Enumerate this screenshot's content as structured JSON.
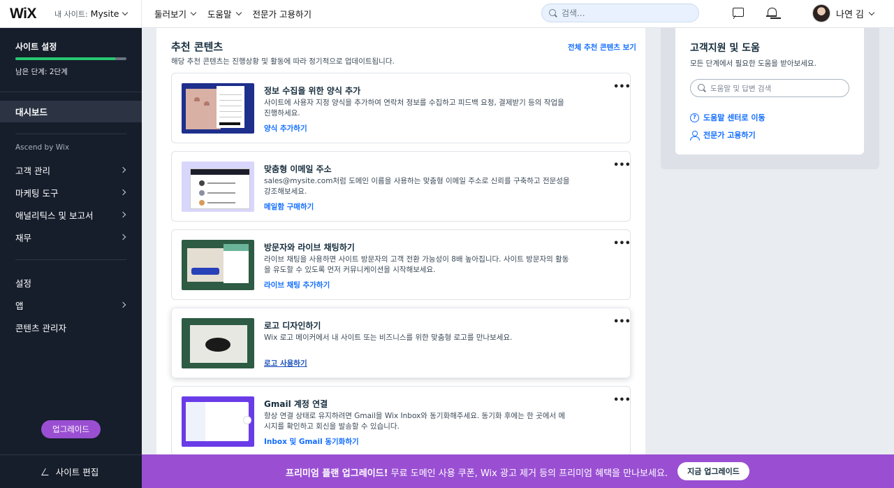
{
  "topbar": {
    "logo": "WiX",
    "site_label": "내 사이트:",
    "site_name": "Mysite",
    "nav": [
      "둘러보기",
      "도움말",
      "전문가 고용하기"
    ],
    "search_placeholder": "검색...",
    "user_name": "나연 김"
  },
  "sidebar": {
    "setup_title": "사이트 설정",
    "setup_steps": "남은 단계: 2단계",
    "setup_progress": 0.9,
    "dashboard": "대시보드",
    "group_label": "Ascend by Wix",
    "group_items": [
      "고객 관리",
      "마케팅 도구",
      "애널리틱스 및 보고서",
      "재무"
    ],
    "settings": "설정",
    "apps": "앱",
    "content_manager": "콘텐츠 관리자",
    "upgrade": "업그레이드",
    "edit_site": "사이트 편집"
  },
  "main": {
    "title": "추천 콘텐츠",
    "subtitle": "해당 추천 콘텐츠는 진행상황 및 활동에 따라 정기적으로 업데이트됩니다.",
    "see_all": "전체 추천 콘텐츠 보기",
    "more_label": "•••",
    "cards": [
      {
        "title": "정보 수집을 위한 양식 추가",
        "desc": "사이트에 사용자 지정 양식을 추가하여 연락처 정보를 수집하고 피드백 요청, 결제받기 등의 작업을 진행하세요.",
        "link": "양식 추가하기"
      },
      {
        "title": "맞춤형 이메일 주소",
        "desc": "sales@mysite.com처럼 도메인 이름을 사용하는 맞춤형 이메일 주소로 신뢰를 구축하고 전문성을 강조해보세요.",
        "link": "메일함 구매하기"
      },
      {
        "title": "방문자와 라이브 채팅하기",
        "desc": "라이브 채팅을 사용하면 사이트 방문자의 고객 전환 가능성이 8배 높아집니다. 사이트 방문자의 활동을 유도할 수 있도록 먼저 커뮤니케이션을 시작해보세요.",
        "link": "라이브 채팅 추가하기"
      },
      {
        "title": "로고 디자인하기",
        "desc": "Wix 로고 메이커에서 내 사이트 또는 비즈니스를 위한 맞춤형 로고를 만나보세요.",
        "link": "로고 사용하기"
      },
      {
        "title": "Gmail 계정 연결",
        "desc": "항상 연결 상태로 유지하려면 Gmail을 Wix Inbox와 동기화해주세요. 동기화 후에는 한 곳에서 메시지를 확인하고 회신을 발송할 수 있습니다.",
        "link": "Inbox 및 Gmail 동기화하기"
      }
    ]
  },
  "help": {
    "title": "고객지원 및 도움",
    "subtitle": "모든 단계에서 필요한 도움을 받아보세요.",
    "search_placeholder": "도움말 및 답변 검색",
    "links": [
      "도움말 센터로 이동",
      "전문가 고용하기"
    ]
  },
  "banner": {
    "bold": "프리미엄 플랜 업그레이드!",
    "text": " 무료 도메인 사용 쿠폰, Wix 광고 제거 등의 프리미엄 혜택을 만나보세요.",
    "cta": "지금 업그레이드"
  },
  "colors": {
    "accent": "#116dff",
    "sidebar_bg": "#161d2b",
    "premium": "#9a4fd3",
    "progress": "#28c76f"
  }
}
